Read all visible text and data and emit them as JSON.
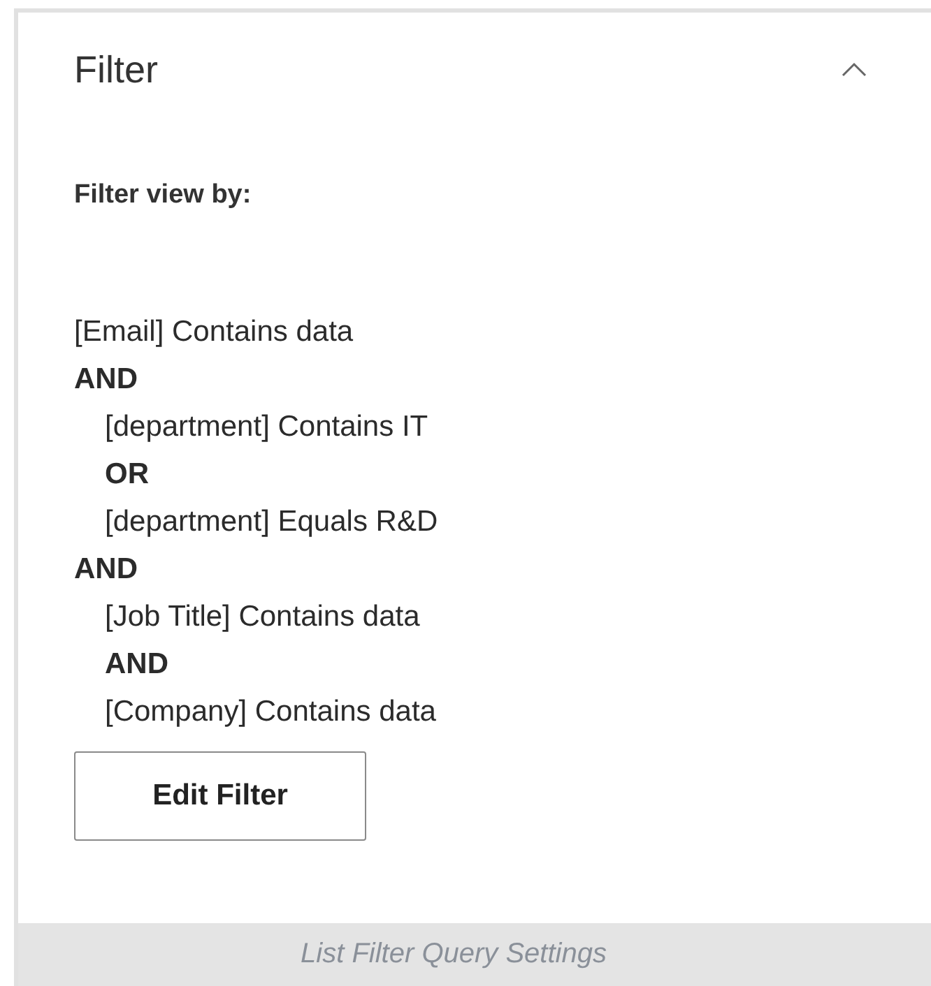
{
  "panel": {
    "title": "Filter",
    "expanded": true,
    "heading": "Filter view by:",
    "filter": [
      {
        "kind": "condition",
        "text": "[Email] Contains data"
      },
      {
        "kind": "operator",
        "text": "AND"
      },
      {
        "kind": "group",
        "children": [
          {
            "kind": "condition",
            "text": "[department] Contains IT"
          },
          {
            "kind": "operator",
            "text": "OR"
          },
          {
            "kind": "condition",
            "text": "[department] Equals R&D"
          }
        ]
      },
      {
        "kind": "operator",
        "text": "AND"
      },
      {
        "kind": "group",
        "children": [
          {
            "kind": "condition",
            "text": "[Job Title] Contains data"
          },
          {
            "kind": "operator",
            "text": "AND"
          },
          {
            "kind": "condition",
            "text": "[Company] Contains data"
          }
        ]
      }
    ],
    "button": "Edit Filter"
  },
  "caption": "List Filter Query Settings"
}
